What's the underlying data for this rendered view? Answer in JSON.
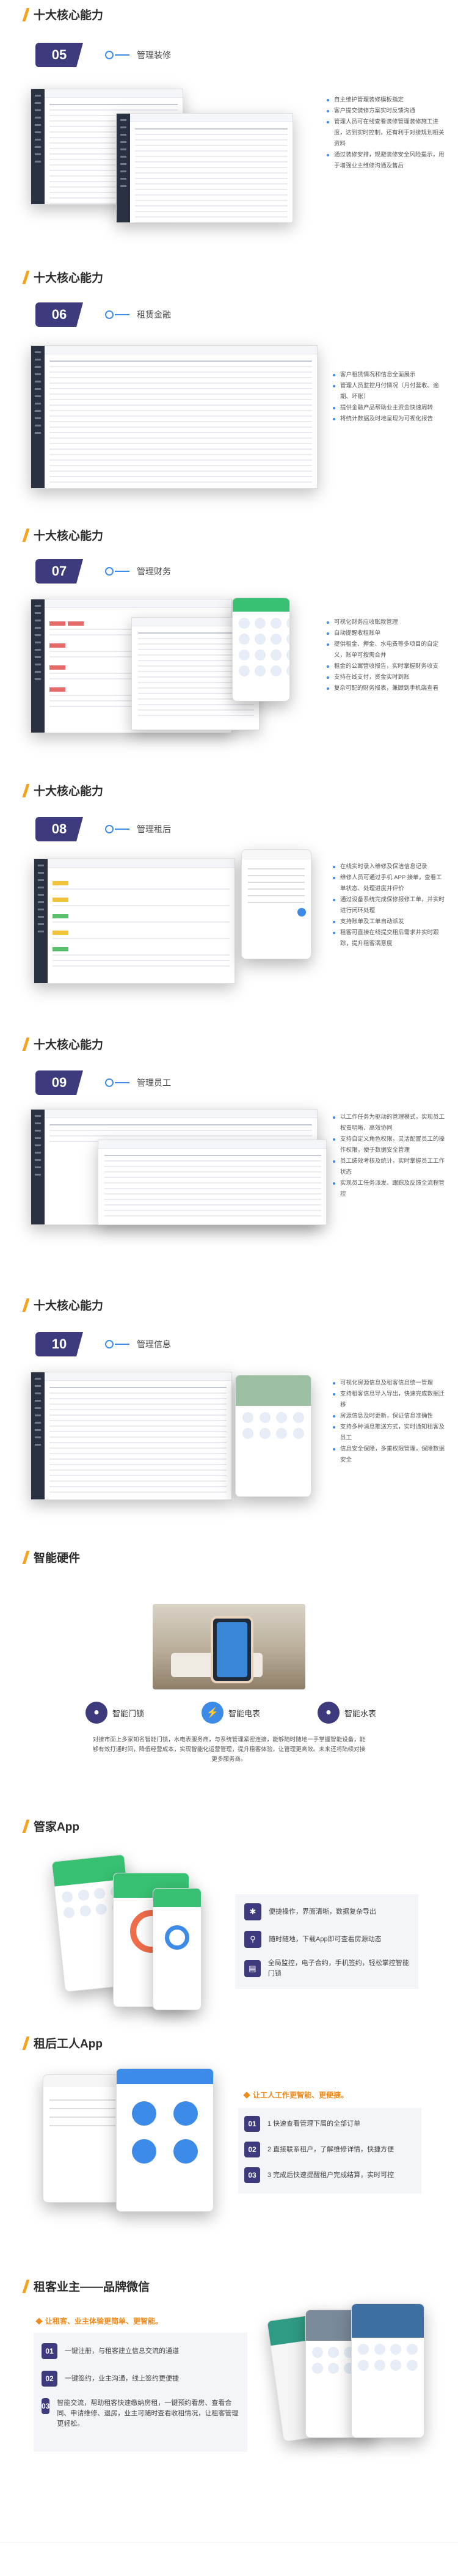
{
  "sections": [
    {
      "heading": "十大核心能力",
      "num": "05",
      "title": "管理装修",
      "bullets": [
        "自主维护管理装修模板指定",
        "客户提交装修方案实时反馈沟通",
        "管理人员可在线查看装修管理装修施工进度，达到实时控制，还有利于对接规划相关资料",
        "通过装修安排，规避装修安全风险提示，用于增强业主维修沟通及售后"
      ]
    },
    {
      "heading": "十大核心能力",
      "num": "06",
      "title": "租赁金融",
      "bullets": [
        "客户租赁情况和信息全面展示",
        "管理人员监控月付情况（月付营收、逾期、坏账）",
        "提供金融产品帮助业主资金快速周转",
        "将统计数据及时地呈现为可视化报告"
      ]
    },
    {
      "heading": "十大核心能力",
      "num": "07",
      "title": "管理财务",
      "bullets": [
        "可视化财务应收账款管理",
        "自动提醒收租账单",
        "提供租金、押金、水电费等多项目的自定义，账单可按需合并",
        "租金的公寓营收报告，实时掌握财务收支",
        "支持在线支付，资金实时到账",
        "复杂可配的财务报表，兼顾到手机端查看"
      ]
    },
    {
      "heading": "十大核心能力",
      "num": "08",
      "title": "管理租后",
      "bullets": [
        "在线实时录入维修及保洁信息记录",
        "维修人员可通过手机 APP 接单，查看工单状态、处理进度并评价",
        "通过设备系统完成保修报修工单，并实时进行闭环处理",
        "支持账单及工单自动派发",
        "租客可直接在线提交租后需求并实时跟踪，提升租客满意度"
      ]
    },
    {
      "heading": "十大核心能力",
      "num": "09",
      "title": "管理员工",
      "bullets": [
        "以工作任务为驱动的管理模式，实现员工权责明晰、高效协同",
        "支持自定义角色权限，灵活配置员工的操作权限，便于数据安全管理",
        "员工绩效考核及统计，实时掌握员工工作状态",
        "实现员工任务派发、跟踪及反馈全流程管控"
      ]
    },
    {
      "heading": "十大核心能力",
      "num": "10",
      "title": "管理信息",
      "bullets": [
        "可视化房源信息及租客信息统一管理",
        "支持租客信息导入导出，快速完成数据迁移",
        "房源信息及时更新，保证信息准确性",
        "支持多种消息推送方式，实时通知租客及员工",
        "信息安全保障，多重权限管理，保障数据安全"
      ]
    }
  ],
  "hardware": {
    "heading": "智能硬件",
    "items": [
      {
        "icon": "lock-icon",
        "label": "智能门锁",
        "color": "#3d3a7e"
      },
      {
        "icon": "meter-icon",
        "label": "智能电表",
        "color": "#3d8be8"
      },
      {
        "icon": "water-icon",
        "label": "智能水表",
        "color": "#3d3a7e"
      }
    ],
    "desc": "对接市面上多家知名智能门锁，水电表服务商，与系统管理紧密连接，能够随时随地一手掌握智能设备，能够有效打通时间，降低经营成本，实现智能化运营管理，提升租客体验，让管理更高效。未来还将陆续对接更多服务商。"
  },
  "butler": {
    "heading": "管家App",
    "features": [
      "便捷操作，界面清晰，数据复杂导出",
      "随时随地，下载App即可查看房源动态",
      "全局监控，电子合约，手机签约，轻松掌控智能门锁"
    ]
  },
  "worker": {
    "heading": "租后工人App",
    "tagline": "让工人工作更智能、更便捷。",
    "items": [
      "1 快速查看管理下属的全部订单",
      "2 直接联系租户，了解维修详情，快捷方便",
      "3 完成后快速提醒租户完成结算，实时可控"
    ]
  },
  "wechat": {
    "heading": "租客业主——品牌微信",
    "tagline": "让租客、业主体验更简单、更智能。",
    "items": [
      "一键注册，与租客建立信息交流的通道",
      "一键签约，业主沟通，线上签约更便捷",
      "智能交流，帮助租客快速缴纳房租，一键预约看房、查看合同、申请维修、退房，业主可随时查看收租情况，让租客管理更轻松。"
    ]
  }
}
